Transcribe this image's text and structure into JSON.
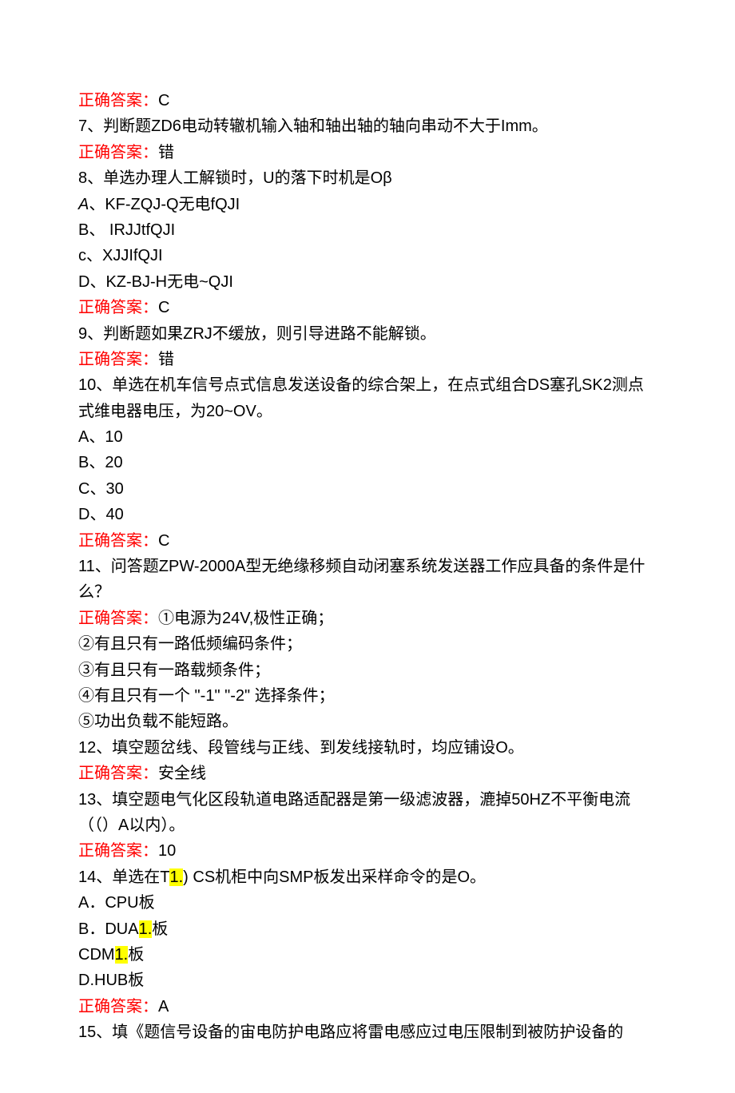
{
  "lines": [
    {
      "segments": [
        {
          "t": "正确答案：",
          "red": true
        },
        {
          "t": "C"
        }
      ]
    },
    {
      "segments": [
        {
          "t": "7、判断题ZD6电动转辙机输入轴和轴出轴的轴向串动不大于Imm。"
        }
      ]
    },
    {
      "segments": [
        {
          "t": "正确答案：",
          "red": true
        },
        {
          "t": "错"
        }
      ]
    },
    {
      "segments": [
        {
          "t": "8、单选办理人工解锁时，U的落下时机是O"
        },
        {
          "t": "β",
          "sub": true
        }
      ]
    },
    {
      "segments": [
        {
          "t": "A",
          "ital": true
        },
        {
          "t": "、KF-ZQJ-Q无电fQJI"
        }
      ]
    },
    {
      "segments": [
        {
          "t": "B、 IRJJtfQJI"
        }
      ]
    },
    {
      "segments": [
        {
          "t": "c、XJJIfQJI"
        }
      ]
    },
    {
      "segments": [
        {
          "t": "D、KZ-BJ-H无电~QJI"
        }
      ]
    },
    {
      "segments": [
        {
          "t": "正确答案：",
          "red": true
        },
        {
          "t": "C"
        }
      ]
    },
    {
      "segments": [
        {
          "t": "9、判断题如果ZRJ不缓放，则引导进路不能解锁。"
        }
      ]
    },
    {
      "segments": [
        {
          "t": "正确答案：",
          "red": true
        },
        {
          "t": "错"
        }
      ]
    },
    {
      "segments": [
        {
          "t": "10、单选在机车信号点式信息发送设备的综合架上，在点式组合DS塞孔SK2测点式维电器电压，为20~OV。"
        }
      ]
    },
    {
      "segments": [
        {
          "t": "A、10"
        }
      ]
    },
    {
      "segments": [
        {
          "t": "B、20"
        }
      ]
    },
    {
      "segments": [
        {
          "t": "C、30"
        }
      ]
    },
    {
      "segments": [
        {
          "t": "D、40"
        }
      ]
    },
    {
      "segments": [
        {
          "t": "正确答案：",
          "red": true
        },
        {
          "t": "C"
        }
      ]
    },
    {
      "segments": [
        {
          "t": "11、问答题ZPW-2000A型无绝缘移频自动闭塞系统发送器工作应具备的条件是什么？"
        }
      ]
    },
    {
      "segments": [
        {
          "t": "正确答案：",
          "red": true
        },
        {
          "t": "①电源为24V,极性正确；"
        }
      ]
    },
    {
      "segments": [
        {
          "t": "②有且只有一路低频编码条件；"
        }
      ]
    },
    {
      "segments": [
        {
          "t": "③有且只有一路载频条件；"
        }
      ]
    },
    {
      "segments": [
        {
          "t": "④有且只有一个 \"-1\" \"-2\" 选择条件；"
        }
      ]
    },
    {
      "segments": [
        {
          "t": "⑤功出负载不能短路。"
        }
      ]
    },
    {
      "segments": [
        {
          "t": "12、填空题岔线、段管线与正线、到发线接轨时，均应铺设O。"
        }
      ]
    },
    {
      "segments": [
        {
          "t": "正确答案：",
          "red": true
        },
        {
          "t": "安全线"
        }
      ]
    },
    {
      "segments": [
        {
          "t": "13、填空题电气化区段轨道电路适配器是第一级滤波器，漉掉50HZ不平衡电流（（）A以内）。"
        }
      ]
    },
    {
      "segments": [
        {
          "t": "正确答案：",
          "red": true
        },
        {
          "t": "10"
        }
      ]
    },
    {
      "segments": [
        {
          "t": "14、单选在T"
        },
        {
          "t": "1.",
          "hl": true
        },
        {
          "t": ") CS机柜中向SMP板发出采样命令的是O。"
        }
      ]
    },
    {
      "segments": [
        {
          "t": "A．CPU板"
        }
      ]
    },
    {
      "segments": [
        {
          "t": "B．DUA"
        },
        {
          "t": "1.",
          "hl": true
        },
        {
          "t": "板"
        }
      ]
    },
    {
      "segments": [
        {
          "t": "CDM"
        },
        {
          "t": "1.",
          "hl": true
        },
        {
          "t": "板"
        }
      ]
    },
    {
      "segments": [
        {
          "t": "D.HUB板"
        }
      ]
    },
    {
      "segments": [
        {
          "t": "正确答案：",
          "red": true
        },
        {
          "t": "A"
        }
      ]
    },
    {
      "segments": [
        {
          "t": "15、填《题信号设备的宙电防护电路应将雷电感应过电压限制到被防护设备的"
        }
      ]
    }
  ]
}
